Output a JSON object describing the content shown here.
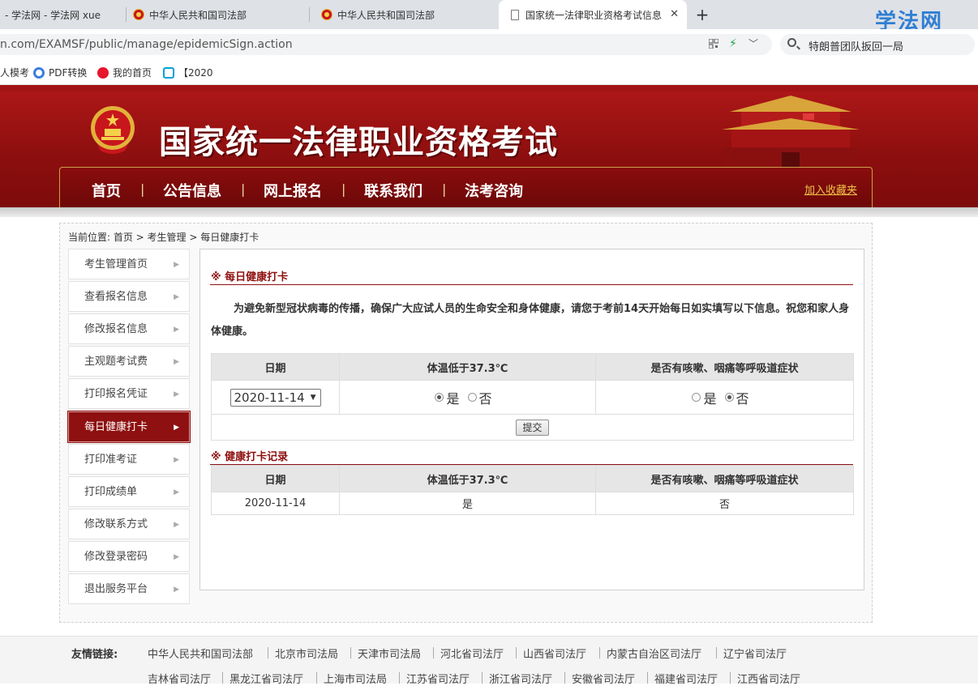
{
  "browser": {
    "tabs": [
      {
        "title": "- 学法网 - 学法网 xue"
      },
      {
        "title": "中华人民共和国司法部"
      },
      {
        "title": "中华人民共和国司法部"
      },
      {
        "title": "国家统一法律职业资格考试信息"
      }
    ],
    "url": "n.com/EXAMSF/public/manage/epidemicSign.action",
    "search_text": "特朗普团队扳回一局",
    "watermark": "学法网",
    "bookmarks": [
      "人模考",
      "PDF转换",
      "我的首页",
      "【2020"
    ]
  },
  "site": {
    "title": "国家统一法律职业资格考试",
    "nav": [
      "首页",
      "公告信息",
      "网上报名",
      "联系我们",
      "法考咨询"
    ],
    "nav_separator": "|",
    "add_favorite": "加入收藏夹"
  },
  "breadcrumb": "当前位置: 首页 > 考生管理 > 每日健康打卡",
  "sidebar": {
    "items": [
      {
        "label": "考生管理首页",
        "active": false
      },
      {
        "label": "查看报名信息",
        "active": false
      },
      {
        "label": "修改报名信息",
        "active": false
      },
      {
        "label": "主观题考试费",
        "active": false
      },
      {
        "label": "打印报名凭证",
        "active": false
      },
      {
        "label": "每日健康打卡",
        "active": true
      },
      {
        "label": "打印准考证",
        "active": false
      },
      {
        "label": "打印成绩单",
        "active": false
      },
      {
        "label": "修改联系方式",
        "active": false
      },
      {
        "label": "修改登录密码",
        "active": false
      },
      {
        "label": "退出服务平台",
        "active": false
      }
    ],
    "arrow": "▶"
  },
  "health_form": {
    "section_title": "※ 每日健康打卡",
    "notice": "为避免新型冠状病毒的传播，确保广大应试人员的生命安全和身体健康，请您于考前14天开始每日如实填写以下信息。祝您和家人身体健康。",
    "columns": [
      "日期",
      "体温低于37.3℃",
      "是否有咳嗽、咽痛等呼吸道症状"
    ],
    "selected_date": "2020-11-14",
    "option_yes": "是",
    "option_no": "否",
    "temperature_selected": "是",
    "symptom_selected": "否",
    "submit_label": "提交"
  },
  "records": {
    "section_title": "※ 健康打卡记录",
    "columns": [
      "日期",
      "体温低于37.3℃",
      "是否有咳嗽、咽痛等呼吸道症状"
    ],
    "rows": [
      {
        "date": "2020-11-14",
        "temperature": "是",
        "symptoms": "否"
      }
    ]
  },
  "footer": {
    "links_label": "友情链接:",
    "row1": [
      "中华人民共和国司法部",
      "北京市司法局",
      "天津市司法局",
      "河北省司法厅",
      "山西省司法厅",
      "内蒙古自治区司法厅",
      "辽宁省司法厅"
    ],
    "row2": [
      "吉林省司法厅",
      "黑龙江省司法厅",
      "上海市司法局",
      "江苏省司法厅",
      "浙江省司法厅",
      "安徽省司法厅",
      "福建省司法厅",
      "江西省司法厅"
    ]
  },
  "colors": {
    "brand_red": "#8e1010",
    "banner_red": "#b01818",
    "gold": "#f2c34a"
  }
}
